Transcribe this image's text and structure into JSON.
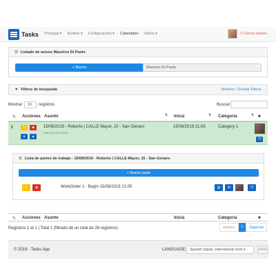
{
  "navbar": {
    "brand": "Tasks",
    "menu": [
      "Principal ▾",
      "Auxiliar ▾",
      "Configuración ▾",
      "Calendario",
      "Varios ▾"
    ],
    "logout": "⎋ Cerrar sesión"
  },
  "avisos": {
    "title": "Listado de avisos Mauricio Di Paolo",
    "new_button": "+ Nuevo",
    "user_select": "Mauricio Di Paolo"
  },
  "filters": {
    "title": "Filtros de búsqueda",
    "toggle": "Mostrar / Ocultar Filtros"
  },
  "table": {
    "show_label": "Mostrar",
    "show_value": "10",
    "records_label": "registros",
    "search_label": "Buscar:",
    "headers": [
      "Acciones",
      "Asunto",
      "Inicia",
      "Categoría"
    ],
    "row": {
      "subject": "15/08/2019 - Roberto | CALLE Mayor, 10 - San Genaro",
      "author": "Mauricio Di Paolo",
      "start": "15/08/2019 21:05",
      "category": "Category 1"
    },
    "info": "Registros 1 al 1 | Total 1 (filtrado de un total de 26 registros)",
    "prev": "Anterior",
    "page": "1",
    "next": "Siguiente"
  },
  "workorders": {
    "title": "Lista de partes de trabajo - 15/08/2019 - Roberto | CALLE Mayor, 10 - San Genaro",
    "new_button": "+ Nuevo parte",
    "item": "WorkOrder 1 - Begin 15/08/2019 21:05"
  },
  "footer": {
    "copyright": "© 2019 - Tasks App",
    "language_label": "LANGUAGE:",
    "language_value": "Spanish (Spain, International Sort) ▾",
    "save": "SAVE"
  },
  "colors": {
    "primary": "#1e88e5",
    "warning": "#f9c400",
    "danger": "#d9302c",
    "row_success": "#cde9cf"
  }
}
